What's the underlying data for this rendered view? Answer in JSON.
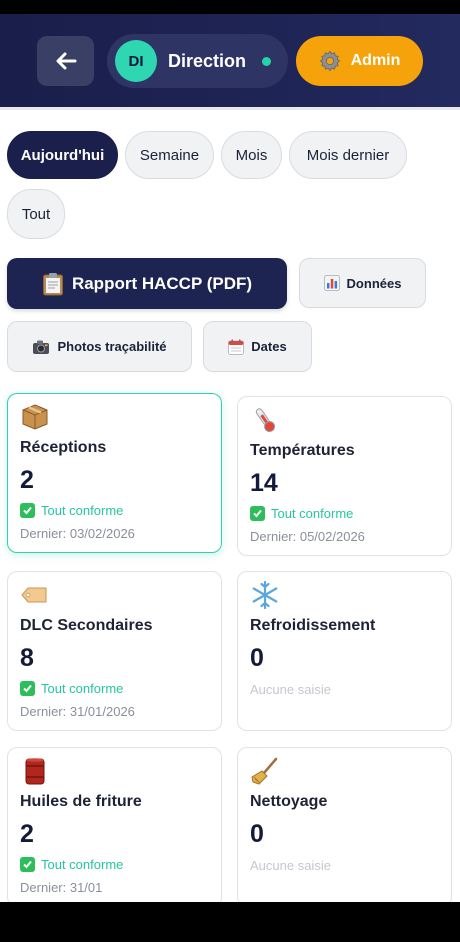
{
  "header": {
    "user": {
      "initials": "DI",
      "name": "Direction"
    },
    "role_label": "Admin"
  },
  "filters": [
    {
      "label": "Aujourd'hui",
      "active": true
    },
    {
      "label": "Semaine",
      "active": false
    },
    {
      "label": "Mois",
      "active": false
    },
    {
      "label": "Mois dernier",
      "active": false
    },
    {
      "label": "Tout",
      "active": false
    }
  ],
  "actions": {
    "report": "Rapport HACCP (PDF)",
    "data": "Données",
    "photos": "Photos traçabilité",
    "dates": "Dates"
  },
  "cards": [
    {
      "icon": "box-icon",
      "title": "Réceptions",
      "count": "2",
      "status": "Tout conforme",
      "last": "Dernier: 03/02/2026"
    },
    {
      "icon": "thermometer-icon",
      "title": "Températures",
      "count": "14",
      "status": "Tout conforme",
      "last": "Dernier: 05/02/2026"
    },
    {
      "icon": "tag-icon",
      "title": "DLC Secondaires",
      "count": "8",
      "status": "Tout conforme",
      "last": "Dernier: 31/01/2026"
    },
    {
      "icon": "snowflake-icon",
      "title": "Refroidissement",
      "count": "0",
      "status": "Aucune saisie",
      "last": ""
    },
    {
      "icon": "oil-barrel-icon",
      "title": "Huiles de friture",
      "count": "2",
      "status": "Tout conforme",
      "last": "Dernier: 31/01"
    },
    {
      "icon": "broom-icon",
      "title": "Nettoyage",
      "count": "0",
      "status": "Aucune saisie",
      "last": ""
    }
  ],
  "colors": {
    "header_bg": "#1f2456",
    "accent_teal": "#2fd6b2",
    "admin_orange": "#f5a20b",
    "active_chip": "#1a1f4b",
    "status_ok": "#26c6a0"
  }
}
